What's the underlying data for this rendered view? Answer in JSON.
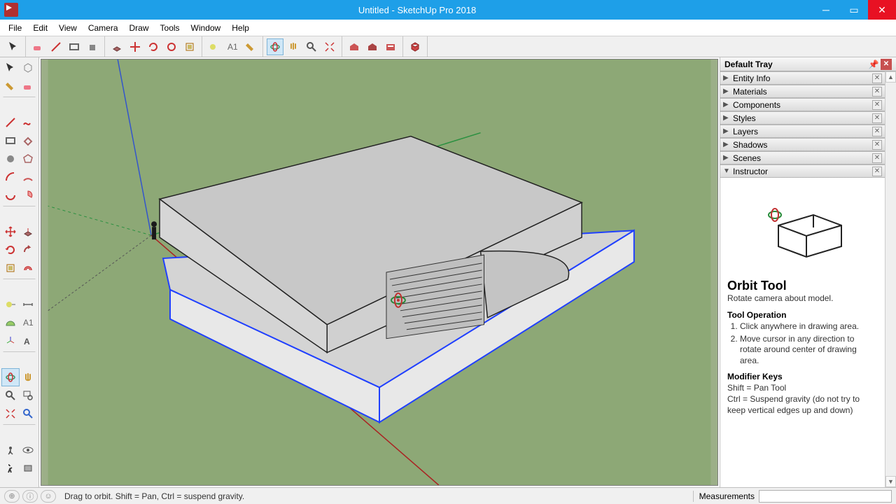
{
  "window": {
    "title": "Untitled - SketchUp Pro 2018"
  },
  "menu": [
    "File",
    "Edit",
    "View",
    "Camera",
    "Draw",
    "Tools",
    "Window",
    "Help"
  ],
  "tray": {
    "title": "Default Tray",
    "panels": [
      {
        "label": "Entity Info",
        "open": false
      },
      {
        "label": "Materials",
        "open": false
      },
      {
        "label": "Components",
        "open": false
      },
      {
        "label": "Styles",
        "open": false
      },
      {
        "label": "Layers",
        "open": false
      },
      {
        "label": "Shadows",
        "open": false
      },
      {
        "label": "Scenes",
        "open": false
      },
      {
        "label": "Instructor",
        "open": true
      }
    ]
  },
  "instructor": {
    "title": "Orbit Tool",
    "subtitle": "Rotate camera about model.",
    "op_heading": "Tool Operation",
    "op1": "Click anywhere in drawing area.",
    "op2": "Move cursor in any direction to rotate around center of drawing area.",
    "mod_heading": "Modifier Keys",
    "mod1": "Shift = Pan Tool",
    "mod2": "Ctrl = Suspend gravity (do not try to keep vertical edges up and down)"
  },
  "status": {
    "hint": "Drag to orbit. Shift = Pan, Ctrl = suspend gravity.",
    "measure_label": "Measurements"
  },
  "colors": {
    "viewport_bg": "#8ea878",
    "accent": "#1e9fe8"
  }
}
